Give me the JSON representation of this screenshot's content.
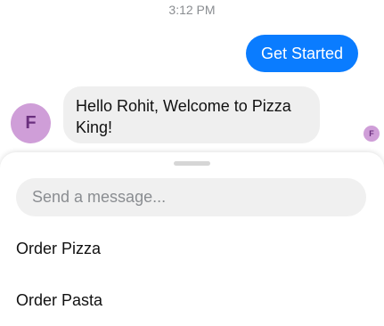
{
  "conversation": {
    "timestamp": "3:12 PM",
    "outgoing_message": "Get Started",
    "bot_avatar_letter": "F",
    "incoming_message": "Hello Rohit, Welcome to Pizza King!",
    "seen_avatar_letter": "F"
  },
  "composer": {
    "placeholder": "Send a message...",
    "quick_replies": [
      "Order Pizza",
      "Order Pasta"
    ]
  },
  "colors": {
    "accent": "#0a7cff",
    "avatar_bg": "#cf9ed8",
    "incoming_bubble": "#efefef"
  },
  "icons": {
    "avatar": "letter-avatar",
    "seen_indicator": "letter-avatar-small"
  }
}
